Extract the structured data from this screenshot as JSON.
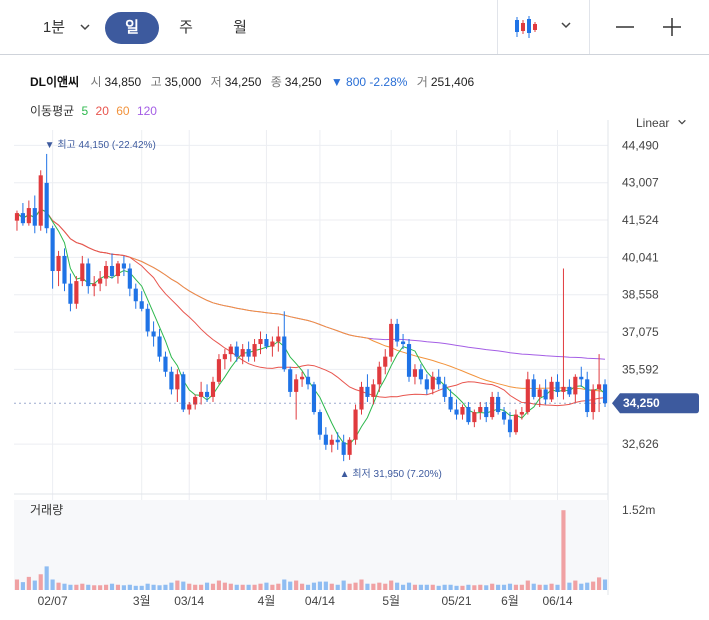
{
  "toolbar": {
    "interval": "1분",
    "tabs": [
      "일",
      "주",
      "월"
    ],
    "active_tab": "일"
  },
  "info": {
    "name": "DL이앤씨",
    "open_label": "시",
    "open": "34,850",
    "high_label": "고",
    "high": "35,000",
    "low_label": "저",
    "low": "34,250",
    "close_label": "종",
    "close": "34,250",
    "change": "▼ 800 -2.28%",
    "volume_label": "거",
    "volume": "251,406"
  },
  "ma_legend": {
    "label": "이동평균",
    "items": [
      {
        "period": "5",
        "color": "#2db84d"
      },
      {
        "period": "20",
        "color": "#e8554e"
      },
      {
        "period": "60",
        "color": "#f2933c"
      },
      {
        "period": "120",
        "color": "#a45ee5"
      }
    ]
  },
  "scale_mode": "Linear",
  "colors": {
    "up": "#e03a3e",
    "down": "#1f73e6",
    "accent": "#3d5a9e"
  },
  "chart_data": {
    "type": "candlestick",
    "price_axis": {
      "ticks": [
        "44,490",
        "43,007",
        "41,524",
        "40,041",
        "38,558",
        "37,075",
        "35,592",
        "32,626"
      ],
      "tick_values": [
        44490,
        43007,
        41524,
        40041,
        38558,
        37075,
        35592,
        32626
      ],
      "ylim": [
        31400,
        45100
      ],
      "current_price": "34,250",
      "current_value": 34250
    },
    "max_marker": {
      "text": "▼ 최고 44,150 (-22.42%)",
      "value": 44150,
      "bar": 5
    },
    "min_marker": {
      "text": "▲ 최저 31,950 (7.20%)",
      "value": 31950,
      "bar": 55
    },
    "volume_label": "거래량",
    "volume_tick": "1.52m",
    "volume_tick_value": 1520000,
    "x_labels": [
      {
        "text": "02/07",
        "bar": 6
      },
      {
        "text": "3월",
        "bar": 21
      },
      {
        "text": "03/14",
        "bar": 29
      },
      {
        "text": "4월",
        "bar": 42
      },
      {
        "text": "04/14",
        "bar": 51
      },
      {
        "text": "5월",
        "bar": 63
      },
      {
        "text": "05/21",
        "bar": 74
      },
      {
        "text": "6월",
        "bar": 83
      },
      {
        "text": "06/14",
        "bar": 91
      }
    ],
    "candles": [
      [
        41500,
        41900,
        41100,
        41800
      ],
      [
        41800,
        42200,
        41300,
        41400
      ],
      [
        41400,
        42300,
        41300,
        42000
      ],
      [
        42000,
        42500,
        41000,
        41300
      ],
      [
        41300,
        43500,
        41100,
        43300
      ],
      [
        43000,
        44150,
        41000,
        41200
      ],
      [
        41200,
        41300,
        38800,
        39500
      ],
      [
        39500,
        40300,
        38900,
        40100
      ],
      [
        40100,
        40400,
        38700,
        39000
      ],
      [
        39000,
        39400,
        37900,
        38200
      ],
      [
        38200,
        39300,
        38000,
        39100
      ],
      [
        39100,
        40100,
        38900,
        39800
      ],
      [
        39800,
        40000,
        38600,
        38900
      ],
      [
        38900,
        39300,
        38500,
        39000
      ],
      [
        39000,
        39500,
        38700,
        39200
      ],
      [
        39200,
        39900,
        38900,
        39700
      ],
      [
        39700,
        40200,
        39200,
        39300
      ],
      [
        39300,
        39900,
        39000,
        39800
      ],
      [
        39800,
        40100,
        39300,
        39600
      ],
      [
        39600,
        39800,
        38500,
        38800
      ],
      [
        38800,
        39000,
        38000,
        38300
      ],
      [
        38300,
        38700,
        37900,
        38000
      ],
      [
        38000,
        38200,
        36900,
        37100
      ],
      [
        37100,
        37500,
        36500,
        36900
      ],
      [
        36900,
        37200,
        35900,
        36100
      ],
      [
        36100,
        36300,
        35300,
        35500
      ],
      [
        35500,
        35700,
        34600,
        34800
      ],
      [
        34800,
        35600,
        34300,
        35400
      ],
      [
        35400,
        35500,
        33900,
        34000
      ],
      [
        34000,
        34300,
        33800,
        34200
      ],
      [
        34200,
        34600,
        34000,
        34500
      ],
      [
        34500,
        35100,
        34200,
        34700
      ],
      [
        34700,
        35000,
        34300,
        34500
      ],
      [
        34500,
        35300,
        34300,
        35100
      ],
      [
        35100,
        36200,
        35000,
        36000
      ],
      [
        36000,
        36400,
        35600,
        36200
      ],
      [
        36200,
        36600,
        35900,
        36500
      ],
      [
        36500,
        36700,
        35900,
        36100
      ],
      [
        36100,
        36600,
        35800,
        36400
      ],
      [
        36400,
        36700,
        35900,
        36100
      ],
      [
        36100,
        36800,
        35900,
        36600
      ],
      [
        36600,
        37100,
        36200,
        36800
      ],
      [
        36800,
        37000,
        36400,
        36500
      ],
      [
        36500,
        36900,
        36100,
        36700
      ],
      [
        36700,
        37300,
        36300,
        36900
      ],
      [
        36900,
        37900,
        35500,
        35600
      ],
      [
        35600,
        35700,
        34500,
        34700
      ],
      [
        34700,
        35400,
        33600,
        35200
      ],
      [
        35200,
        35500,
        34900,
        35300
      ],
      [
        35300,
        35600,
        34800,
        35000
      ],
      [
        35000,
        35100,
        33800,
        33900
      ],
      [
        33900,
        34000,
        32800,
        33000
      ],
      [
        33000,
        33300,
        32400,
        32600
      ],
      [
        32600,
        33000,
        32300,
        32800
      ],
      [
        32800,
        33100,
        32400,
        32700
      ],
      [
        32700,
        33000,
        31950,
        32200
      ],
      [
        32200,
        32900,
        32000,
        32800
      ],
      [
        32800,
        34200,
        32600,
        34000
      ],
      [
        34000,
        35100,
        33800,
        34900
      ],
      [
        34900,
        35400,
        34300,
        34500
      ],
      [
        34500,
        35200,
        34200,
        35000
      ],
      [
        35000,
        35900,
        34700,
        35700
      ],
      [
        35700,
        36400,
        35400,
        36100
      ],
      [
        36100,
        37600,
        35900,
        37400
      ],
      [
        37400,
        37600,
        36500,
        36700
      ],
      [
        36700,
        37000,
        36400,
        36600
      ],
      [
        36600,
        36800,
        35100,
        35300
      ],
      [
        35300,
        35800,
        35000,
        35600
      ],
      [
        35600,
        35800,
        35000,
        35200
      ],
      [
        35200,
        35400,
        34600,
        34800
      ],
      [
        34800,
        35500,
        34600,
        35300
      ],
      [
        35300,
        35600,
        34800,
        35000
      ],
      [
        35000,
        35300,
        34300,
        34500
      ],
      [
        34500,
        34800,
        33900,
        34000
      ],
      [
        34000,
        34400,
        33600,
        33800
      ],
      [
        33800,
        34200,
        33600,
        34100
      ],
      [
        34100,
        34300,
        33400,
        33500
      ],
      [
        33500,
        34000,
        33300,
        33900
      ],
      [
        33900,
        34300,
        33600,
        34100
      ],
      [
        34100,
        34300,
        33500,
        33700
      ],
      [
        33700,
        34700,
        33600,
        34500
      ],
      [
        34500,
        34700,
        33800,
        33900
      ],
      [
        33900,
        34100,
        33400,
        33600
      ],
      [
        33600,
        33900,
        32900,
        33100
      ],
      [
        33100,
        34000,
        33000,
        33800
      ],
      [
        33800,
        34100,
        33600,
        33900
      ],
      [
        33900,
        35500,
        33800,
        35200
      ],
      [
        35200,
        35400,
        34400,
        34500
      ],
      [
        34500,
        35000,
        34100,
        34800
      ],
      [
        34800,
        35200,
        34200,
        34400
      ],
      [
        34400,
        35300,
        34300,
        35100
      ],
      [
        35100,
        35400,
        34500,
        34700
      ],
      [
        34700,
        39600,
        34400,
        34900
      ],
      [
        34900,
        35200,
        34500,
        34600
      ],
      [
        34600,
        35400,
        34300,
        35300
      ],
      [
        35300,
        35700,
        34900,
        35200
      ],
      [
        35200,
        35500,
        33700,
        33900
      ],
      [
        33900,
        35000,
        33600,
        34800
      ],
      [
        34800,
        36200,
        33900,
        35000
      ],
      [
        35000,
        35200,
        34100,
        34250
      ]
    ],
    "volumes": [
      0.2,
      0.15,
      0.25,
      0.18,
      0.3,
      0.45,
      0.2,
      0.14,
      0.12,
      0.1,
      0.1,
      0.12,
      0.1,
      0.09,
      0.09,
      0.1,
      0.12,
      0.1,
      0.09,
      0.1,
      0.08,
      0.08,
      0.12,
      0.1,
      0.09,
      0.1,
      0.14,
      0.18,
      0.16,
      0.12,
      0.1,
      0.1,
      0.14,
      0.12,
      0.18,
      0.14,
      0.12,
      0.1,
      0.1,
      0.1,
      0.1,
      0.12,
      0.14,
      0.1,
      0.12,
      0.2,
      0.16,
      0.18,
      0.12,
      0.1,
      0.14,
      0.16,
      0.16,
      0.12,
      0.1,
      0.18,
      0.12,
      0.14,
      0.2,
      0.12,
      0.12,
      0.14,
      0.12,
      0.18,
      0.14,
      0.1,
      0.14,
      0.1,
      0.1,
      0.1,
      0.1,
      0.08,
      0.1,
      0.1,
      0.08,
      0.08,
      0.1,
      0.09,
      0.1,
      0.09,
      0.12,
      0.1,
      0.1,
      0.12,
      0.1,
      0.1,
      0.18,
      0.12,
      0.1,
      0.1,
      0.12,
      0.1,
      1.52,
      0.14,
      0.18,
      0.12,
      0.14,
      0.16,
      0.24,
      0.2
    ]
  }
}
